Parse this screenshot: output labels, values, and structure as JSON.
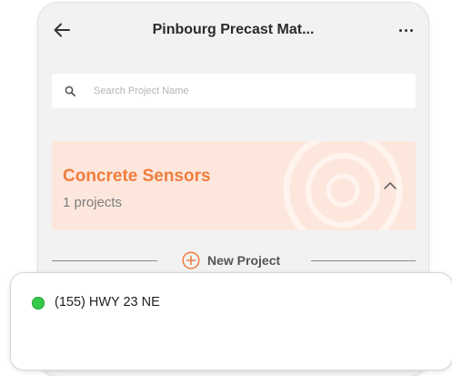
{
  "header": {
    "title": "Pinbourg Precast Mat..."
  },
  "search": {
    "placeholder": "Search Project Name",
    "value": ""
  },
  "project_group": {
    "title": "Concrete Sensors",
    "count_label": "1 projects",
    "expanded": true
  },
  "new_project": {
    "label": "New Project"
  },
  "project_item": {
    "name": "(155) HWY 23 NE",
    "status_color": "#35c94a"
  },
  "colors": {
    "accent_orange": "#f07d3d",
    "group_background": "#fde7dd",
    "screen_background": "#f2f2f2"
  }
}
